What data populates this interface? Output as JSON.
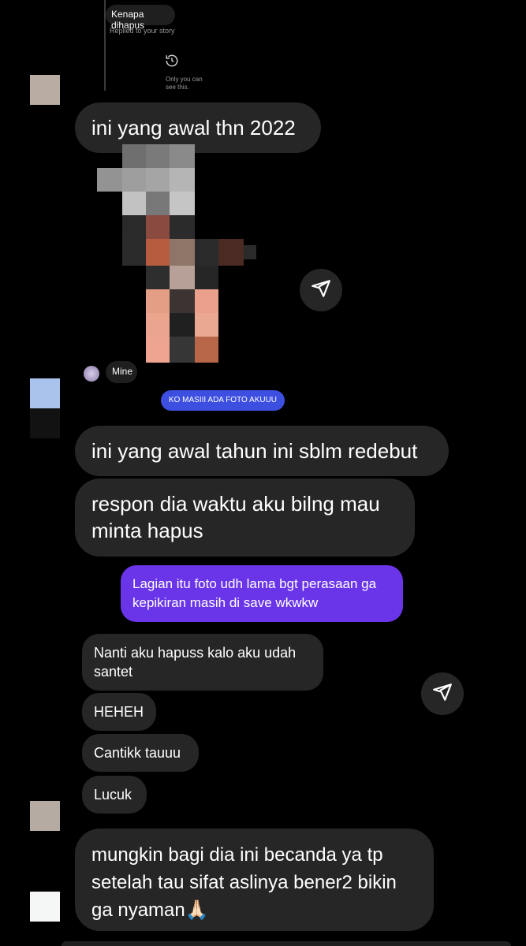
{
  "story_reply": {
    "quoted_text": "Kenapa dihapus",
    "caption": "Replied to your story",
    "notice_icon": "history-icon",
    "notice_text": "Only you can\nsee this."
  },
  "messages": {
    "m1": "ini yang awal thn 2022",
    "story_label": "Mine",
    "chip": "KO MASIII ADA FOTO AKUUU",
    "m2": "ini yang awal tahun ini sblm redebut",
    "m3": "respon dia waktu aku bilng mau minta hapus",
    "sent1": "Lagian itu foto udh lama bgt perasaan ga kepikiran masih di save wkwkw",
    "r1": "Nanti aku hapuss kalo aku udah santet",
    "r2": "HEHEH",
    "r3": "Cantikk tauuu",
    "r4": "Lucuk",
    "m4": "mungkin bagi dia ini becanda ya tp setelah tau sifat aslinya bener2 bikin ga nyaman🙏🏻"
  },
  "icons": {
    "send": "send-icon",
    "history": "history-icon"
  },
  "colors": {
    "background": "#000000",
    "bubble_dark": "#262626",
    "bubble_purple": "#6a35e8",
    "chip_blue": "#3d4fe0"
  }
}
